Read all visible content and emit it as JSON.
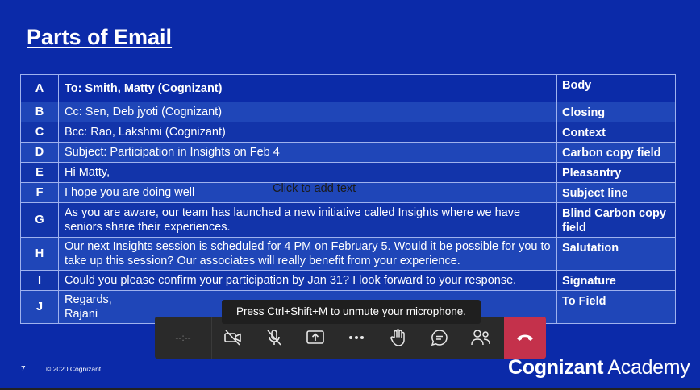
{
  "slide": {
    "title": "Parts of Email",
    "placeholder_text": "Click to add text",
    "page_number": "7",
    "copyright": "© 2020 Cognizant",
    "brand_bold": "Cognizant",
    "brand_rest": " Academy"
  },
  "table": {
    "rows": [
      {
        "letter": "A",
        "text": "To: Smith, Matty (Cognizant)",
        "option": "Body"
      },
      {
        "letter": "B",
        "text": "Cc: Sen, Deb jyoti (Cognizant)",
        "option": "Closing"
      },
      {
        "letter": "C",
        "text": "Bcc: Rao, Lakshmi (Cognizant)",
        "option": "Context"
      },
      {
        "letter": "D",
        "text": "Subject: Participation in Insights on  Feb 4",
        "option": "Carbon copy field"
      },
      {
        "letter": "E",
        "text": "Hi Matty,",
        "option": "Pleasantry"
      },
      {
        "letter": "F",
        "text": "I hope you are doing well",
        "option": "Subject line"
      },
      {
        "letter": "G",
        "text": "As you are aware, our team has launched a new initiative called Insights where we have seniors share their experiences.",
        "option": "Blind Carbon copy field"
      },
      {
        "letter": "H",
        "text": "Our next Insights session is scheduled for 4 PM on February 5. Would it be possible for you to take up this session? Our associates will really benefit from your experience.",
        "option": "Salutation"
      },
      {
        "letter": "I",
        "text": "Could you please confirm your participation by Jan 31? I look forward to your response.",
        "option": "Signature"
      },
      {
        "letter": "J",
        "text_line1": "Regards,",
        "text_line2": "Rajani",
        "option": "To Field"
      }
    ]
  },
  "meeting": {
    "tooltip": "Press Ctrl+Shift+M to unmute your microphone.",
    "timer": "--:--",
    "icons": [
      "camera-off-icon",
      "mic-off-icon",
      "share-screen-icon",
      "more-icon",
      "raise-hand-icon",
      "chat-icon",
      "participants-icon",
      "hang-up-icon"
    ],
    "hangup_color": "#c4314b"
  }
}
